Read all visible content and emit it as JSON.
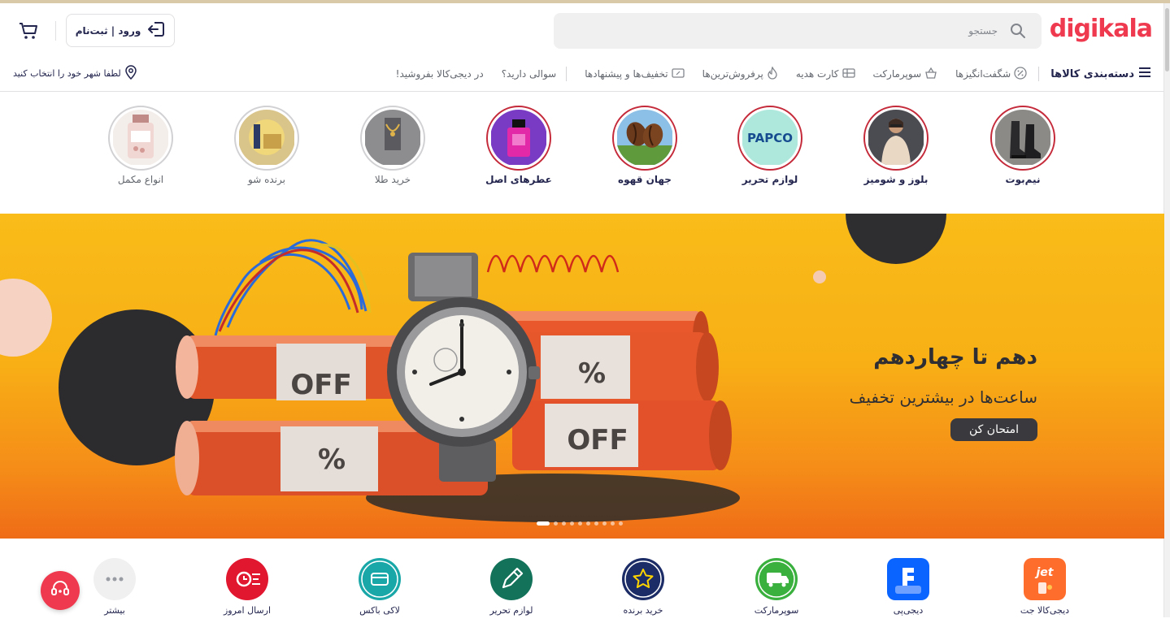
{
  "header": {
    "logo_text": "digikala",
    "search_placeholder": "جستجو",
    "login_label": "ورود | ثبت‌نام",
    "icons": [
      "search-icon",
      "login-icon",
      "cart-icon"
    ]
  },
  "nav": {
    "categories_label": "دسته‌بندی کالاها",
    "items": [
      {
        "label": "شگفت‌انگیزها",
        "icon": "percent-icon"
      },
      {
        "label": "سوپرمارکت",
        "icon": "basket-icon"
      },
      {
        "label": "کارت هدیه",
        "icon": "gift-card-icon"
      },
      {
        "label": "پرفروش‌ترین‌ها",
        "icon": "fire-icon"
      },
      {
        "label": "تخفیف‌ها و پیشنهادها",
        "icon": "coupon-icon"
      },
      {
        "label": "سوالی دارید؟"
      },
      {
        "label": "در دیجی‌کالا بفروشید!"
      }
    ],
    "city_prompt": "لطفا شهر خود را انتخاب کنید"
  },
  "stories": [
    {
      "label": "نیم‌بوت",
      "seen": false
    },
    {
      "label": "بلوز و شومیز",
      "seen": false
    },
    {
      "label": "لوازم تحریر",
      "seen": false
    },
    {
      "label": "جهان قهوه",
      "seen": false
    },
    {
      "label": "عطرهای اصل",
      "seen": false
    },
    {
      "label": "خرید طلا",
      "seen": true
    },
    {
      "label": "برنده شو",
      "seen": true
    },
    {
      "label": "انواع مکمل",
      "seen": true
    }
  ],
  "story_logo_text": "PAPCO",
  "banner": {
    "title": "دهم تا چهاردهم",
    "subtitle": "ساعت‌ها در بیشترین تخفیف",
    "button": "امتحان کن",
    "tag_off": "OFF",
    "tag_percent": "%",
    "slide_count": 10,
    "active_slide": 1
  },
  "quick_links": [
    {
      "label": "دیجی‌کالا جت",
      "color": "#ff6d2d",
      "icon": "jet-icon",
      "icon_text": "jet"
    },
    {
      "label": "دیجی‌پی",
      "color": "#0a64ff",
      "icon": "digipay-icon"
    },
    {
      "label": "سوپرمارکت",
      "color": "#3ab03e",
      "icon": "supermarket-icon"
    },
    {
      "label": "خرید برنده",
      "color": "#1c2c66",
      "icon": "star-icon"
    },
    {
      "label": "لوازم تحریر",
      "color": "#13725a",
      "icon": "pen-icon"
    },
    {
      "label": "لاکی باکس",
      "color": "#1aa7a8",
      "icon": "box-icon"
    },
    {
      "label": "ارسال امروز",
      "color": "#e1162f",
      "icon": "delivery-icon"
    },
    {
      "label": "بیشتر",
      "color": "#f0f0f1",
      "icon": "more-icon"
    }
  ],
  "colors": {
    "brand": "#ef394e",
    "text": "#23254e",
    "muted": "#62666d"
  }
}
